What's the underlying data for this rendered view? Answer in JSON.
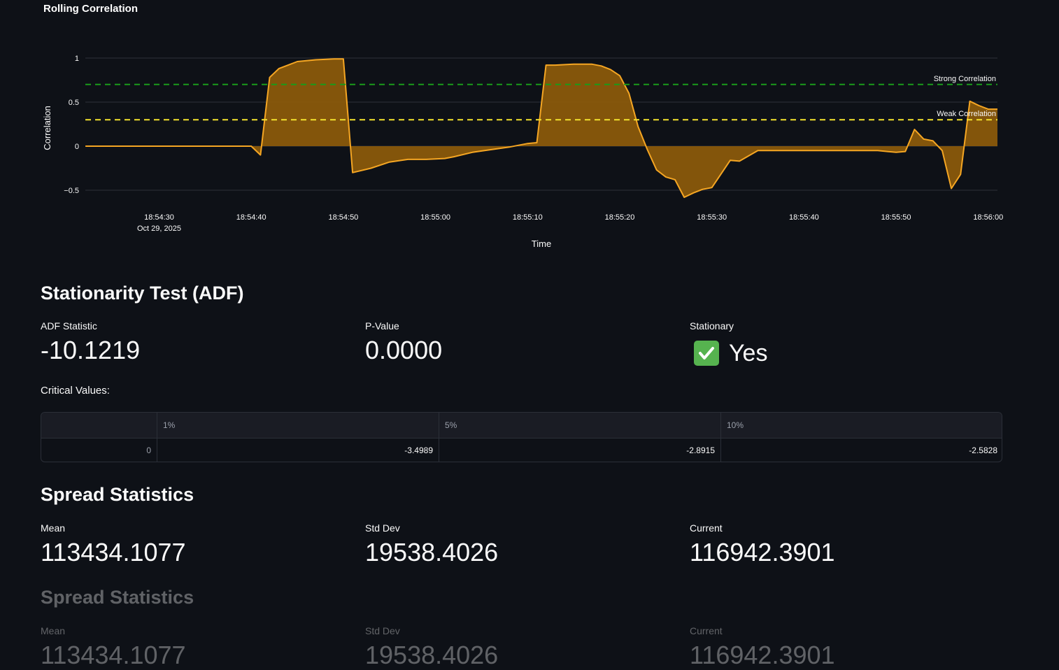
{
  "chart_data": {
    "type": "area",
    "title": "Rolling Correlation",
    "xlabel": "Time",
    "ylabel": "Correlation",
    "ylim": [
      -0.6,
      1.0
    ],
    "yticks": [
      1,
      0.5,
      0,
      -0.5
    ],
    "ytick_labels": [
      "1",
      "0.5",
      "0",
      "−0.5"
    ],
    "x_ticks": [
      "18:54:30",
      "18:54:40",
      "18:54:50",
      "18:55:00",
      "18:55:10",
      "18:55:20",
      "18:55:30",
      "18:55:40",
      "18:55:50",
      "18:56:00"
    ],
    "x_tick_sub": "Oct 29, 2025",
    "x_tick_values": [
      30,
      40,
      50,
      60,
      70,
      80,
      90,
      100,
      110,
      120
    ],
    "xlim": [
      22,
      121
    ],
    "color": "#f5a623",
    "series": [
      {
        "x": [
          22,
          40,
          41,
          42,
          43,
          44,
          45,
          47,
          49,
          50,
          51,
          53,
          55,
          57,
          59,
          61,
          62,
          64,
          66,
          68,
          70,
          71,
          72,
          73,
          75,
          77,
          78,
          79,
          80,
          81,
          82,
          83,
          84,
          85,
          86,
          87,
          88,
          89,
          90,
          92,
          93,
          95,
          97,
          100,
          103,
          106,
          108,
          110,
          111,
          112,
          113,
          114,
          115,
          116,
          117,
          118,
          119,
          120,
          121
        ],
        "values": [
          0,
          0,
          -0.1,
          0.78,
          0.88,
          0.92,
          0.96,
          0.98,
          0.99,
          0.99,
          -0.3,
          -0.25,
          -0.18,
          -0.15,
          -0.15,
          -0.14,
          -0.12,
          -0.07,
          -0.04,
          -0.01,
          0.03,
          0.04,
          0.92,
          0.92,
          0.93,
          0.93,
          0.91,
          0.87,
          0.8,
          0.6,
          0.22,
          -0.04,
          -0.27,
          -0.35,
          -0.38,
          -0.58,
          -0.53,
          -0.49,
          -0.47,
          -0.16,
          -0.17,
          -0.05,
          -0.05,
          -0.05,
          -0.05,
          -0.05,
          -0.05,
          -0.07,
          -0.06,
          0.19,
          0.08,
          0.06,
          -0.05,
          -0.48,
          -0.32,
          0.51,
          0.46,
          0.42,
          0.42
        ]
      }
    ],
    "hlines": [
      {
        "y": 0.7,
        "label": "Strong Correlation",
        "color": "#1a9b1a"
      },
      {
        "y": 0.3,
        "label": "Weak Correlation",
        "color": "#f3e22d"
      }
    ]
  },
  "adf": {
    "title": "Stationarity Test (ADF)",
    "stat_label": "ADF Statistic",
    "stat_value": "-10.1219",
    "p_label": "P-Value",
    "p_value": "0.0000",
    "stationary_label": "Stationary",
    "stationary_value": "Yes",
    "stationary_icon": "check-mark-button-icon",
    "critical_label": "Critical Values:",
    "table": {
      "headers": [
        "",
        "1%",
        "5%",
        "10%"
      ],
      "rows": [
        [
          "0",
          "-3.4989",
          "-2.8915",
          "-2.5828"
        ]
      ]
    }
  },
  "spread": {
    "title": "Spread Statistics",
    "mean_label": "Mean",
    "mean_value": "113434.1077",
    "std_label": "Std Dev",
    "std_value": "19538.4026",
    "current_label": "Current",
    "current_value": "116942.3901"
  },
  "spread_faded": {
    "title": "Spread Statistics",
    "mean_label": "Mean",
    "mean_value": "113434.1077",
    "std_label": "Std Dev",
    "std_value": "19538.4026",
    "current_label": "Current",
    "current_value": "116942.3901"
  }
}
